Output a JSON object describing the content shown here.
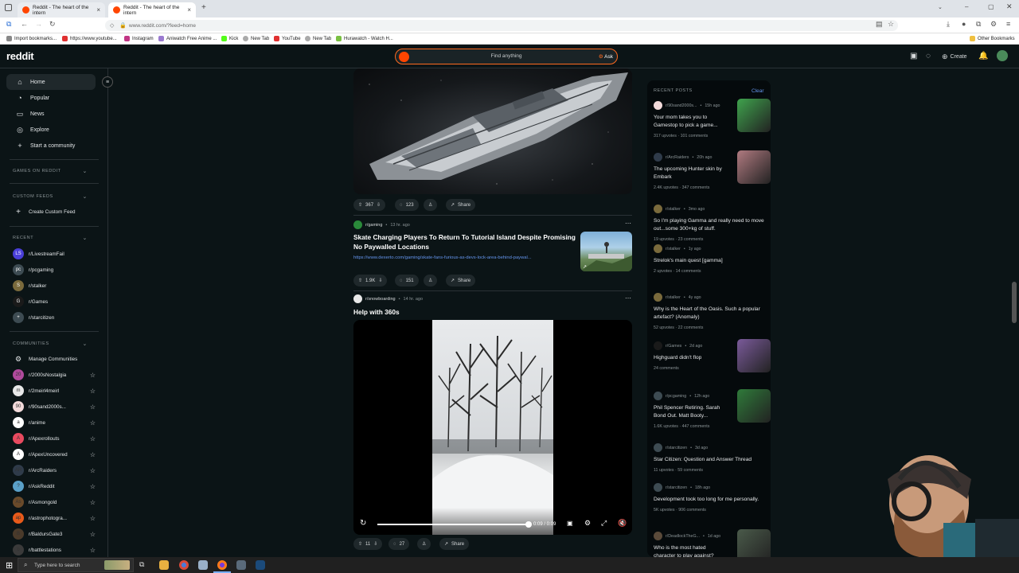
{
  "browser": {
    "tabs": [
      {
        "title": "Reddit - The heart of the intern"
      },
      {
        "title": "Reddit - The heart of the intern"
      }
    ],
    "url": "www.reddit.com/?feed=home",
    "bookmarks": [
      "Import bookmarks...",
      "https://www.youtube...",
      "Instagram",
      "Aniwatch Free Anime ...",
      "Kick",
      "New Tab",
      "YouTube",
      "New Tab",
      "Hurawatch - Watch H..."
    ],
    "other_bookmarks": "Other Bookmarks"
  },
  "header": {
    "logo": "reddit",
    "search_placeholder": "Find anything",
    "ask_label": "Ask",
    "create_label": "Create"
  },
  "sidebar": {
    "nav": [
      {
        "label": "Home",
        "icon": "home-icon"
      },
      {
        "label": "Popular",
        "icon": "popular-icon"
      },
      {
        "label": "News",
        "icon": "news-icon"
      },
      {
        "label": "Explore",
        "icon": "explore-icon"
      },
      {
        "label": "Start a community",
        "icon": "plus-icon"
      }
    ],
    "games_heading": "GAMES ON REDDIT",
    "custom_heading": "CUSTOM FEEDS",
    "create_custom": "Create Custom Feed",
    "recent_heading": "RECENT",
    "recent": [
      {
        "name": "r/LivestreamFail",
        "color": "#4a3fd8",
        "ab": "LS"
      },
      {
        "name": "r/pcgaming",
        "color": "#3d4b52",
        "ab": "pc"
      },
      {
        "name": "r/stalker",
        "color": "#7a6a3c",
        "ab": "S"
      },
      {
        "name": "r/Games",
        "color": "#1a1a1a",
        "ab": "G"
      },
      {
        "name": "r/starcitizen",
        "color": "#3d4b52",
        "ab": "+"
      }
    ],
    "communities_heading": "COMMUNITIES",
    "manage": "Manage Communities",
    "communities": [
      {
        "name": "r/2000sNostalgia",
        "color": "#b04a9c",
        "ab": "20"
      },
      {
        "name": "r/2meirl4meirl",
        "color": "#e8e8e8",
        "ab": "m"
      },
      {
        "name": "r/90sand2000s...",
        "color": "#f2dada",
        "ab": "90"
      },
      {
        "name": "r/anime",
        "color": "#ffffff",
        "ab": "a"
      },
      {
        "name": "r/Apexrollouts",
        "color": "#e84a5f",
        "ab": "A"
      },
      {
        "name": "r/ApexUncovered",
        "color": "#ffffff",
        "ab": "A"
      },
      {
        "name": "r/ArcRaiders",
        "color": "#2f3b4a",
        "ab": "AR"
      },
      {
        "name": "r/AskReddit",
        "color": "#5aa0c8",
        "ab": "?"
      },
      {
        "name": "r/Asmongold",
        "color": "#6a4a2a",
        "ab": "As"
      },
      {
        "name": "r/astrophotogra...",
        "color": "#e85a1a",
        "ab": "ap"
      },
      {
        "name": "r/BaldursGate3",
        "color": "#4a3a2a",
        "ab": "B"
      },
      {
        "name": "r/battlestations",
        "color": "#3a3a3a",
        "ab": "b"
      }
    ]
  },
  "feed": {
    "post1": {
      "votes": "367",
      "comments": "123",
      "share": "Share"
    },
    "post2": {
      "subreddit": "r/gaming",
      "time": "13 hr. ago",
      "title": "Skate Charging Players To Return To Tutorial Island Despite Promising No Paywalled Locations",
      "link": "https://www.dexerto.com/gaming/skate-fans-furious-as-devs-lock-area-behind-paywal...",
      "votes": "1.9K",
      "comments": "151",
      "share": "Share"
    },
    "post3": {
      "subreddit": "r/snowboarding",
      "time": "14 hr. ago",
      "title": "Help with 360s",
      "video_time": "0:09 / 0:09",
      "video_progress": 1.0,
      "votes": "11",
      "comments": "27",
      "share": "Share"
    }
  },
  "recent_posts": {
    "heading": "RECENT POSTS",
    "clear": "Clear",
    "items": [
      {
        "sub": "r/90sand2000s...",
        "time": "15h ago",
        "title": "Your mom takes you to Gamestop to pick a game...",
        "stats": "317 upvotes · 101 comments",
        "color": "#f2dada",
        "thumb": "#3fa34d"
      },
      {
        "sub": "r/ArcRaiders",
        "time": "20h ago",
        "title": "The upcoming Hunter skin by Embark",
        "stats": "2.4K upvotes · 347 comments",
        "color": "#2f3b4a",
        "thumb": "#b07a80"
      },
      {
        "sub": "r/stalker",
        "time": "3mo ago",
        "title": "So I'm playing Gamma and really need to move out...some 300+kg of stuff.",
        "stats": "19 upvotes · 23 comments",
        "color": "#7a6a3c"
      },
      {
        "sub": "r/stalker",
        "time": "1y ago",
        "title": "Strelok's main quest [gamma]",
        "stats": "2 upvotes · 14 comments",
        "color": "#7a6a3c"
      },
      {
        "sub": "r/stalker",
        "time": "4y ago",
        "title": "Why is the Heart of the Oasis. Such a popular artefact? (Anomaly)",
        "stats": "52 upvotes · 22 comments",
        "color": "#7a6a3c"
      },
      {
        "sub": "r/Games",
        "time": "2d ago",
        "title": "Highguard didn't flop",
        "stats": "24 comments",
        "color": "#1a1a1a",
        "thumb": "#7a5a9a"
      },
      {
        "sub": "r/pcgaming",
        "time": "12h ago",
        "title": "Phil Spencer Retiring. Sarah Bond Out. Matt Booty...",
        "stats": "1.6K upvotes · 447 comments",
        "color": "#3d4b52",
        "thumb": "#2f7a3a"
      },
      {
        "sub": "r/starcitizen",
        "time": "3d ago",
        "title": "Star Citizen: Question and Answer Thread",
        "stats": "11 upvotes · 59 comments",
        "color": "#3d4b52"
      },
      {
        "sub": "r/starcitizen",
        "time": "18h ago",
        "title": "Development took too long for me personally.",
        "stats": "5K upvotes · 906 comments",
        "color": "#3d4b52"
      },
      {
        "sub": "r/DeadlockTheG...",
        "time": "1d ago",
        "title": "Who is the most hated character to play against?",
        "stats": "",
        "color": "#5a4a3a",
        "thumb": "#4a5a4a"
      }
    ]
  },
  "taskbar": {
    "search_placeholder": "Type here to search"
  }
}
